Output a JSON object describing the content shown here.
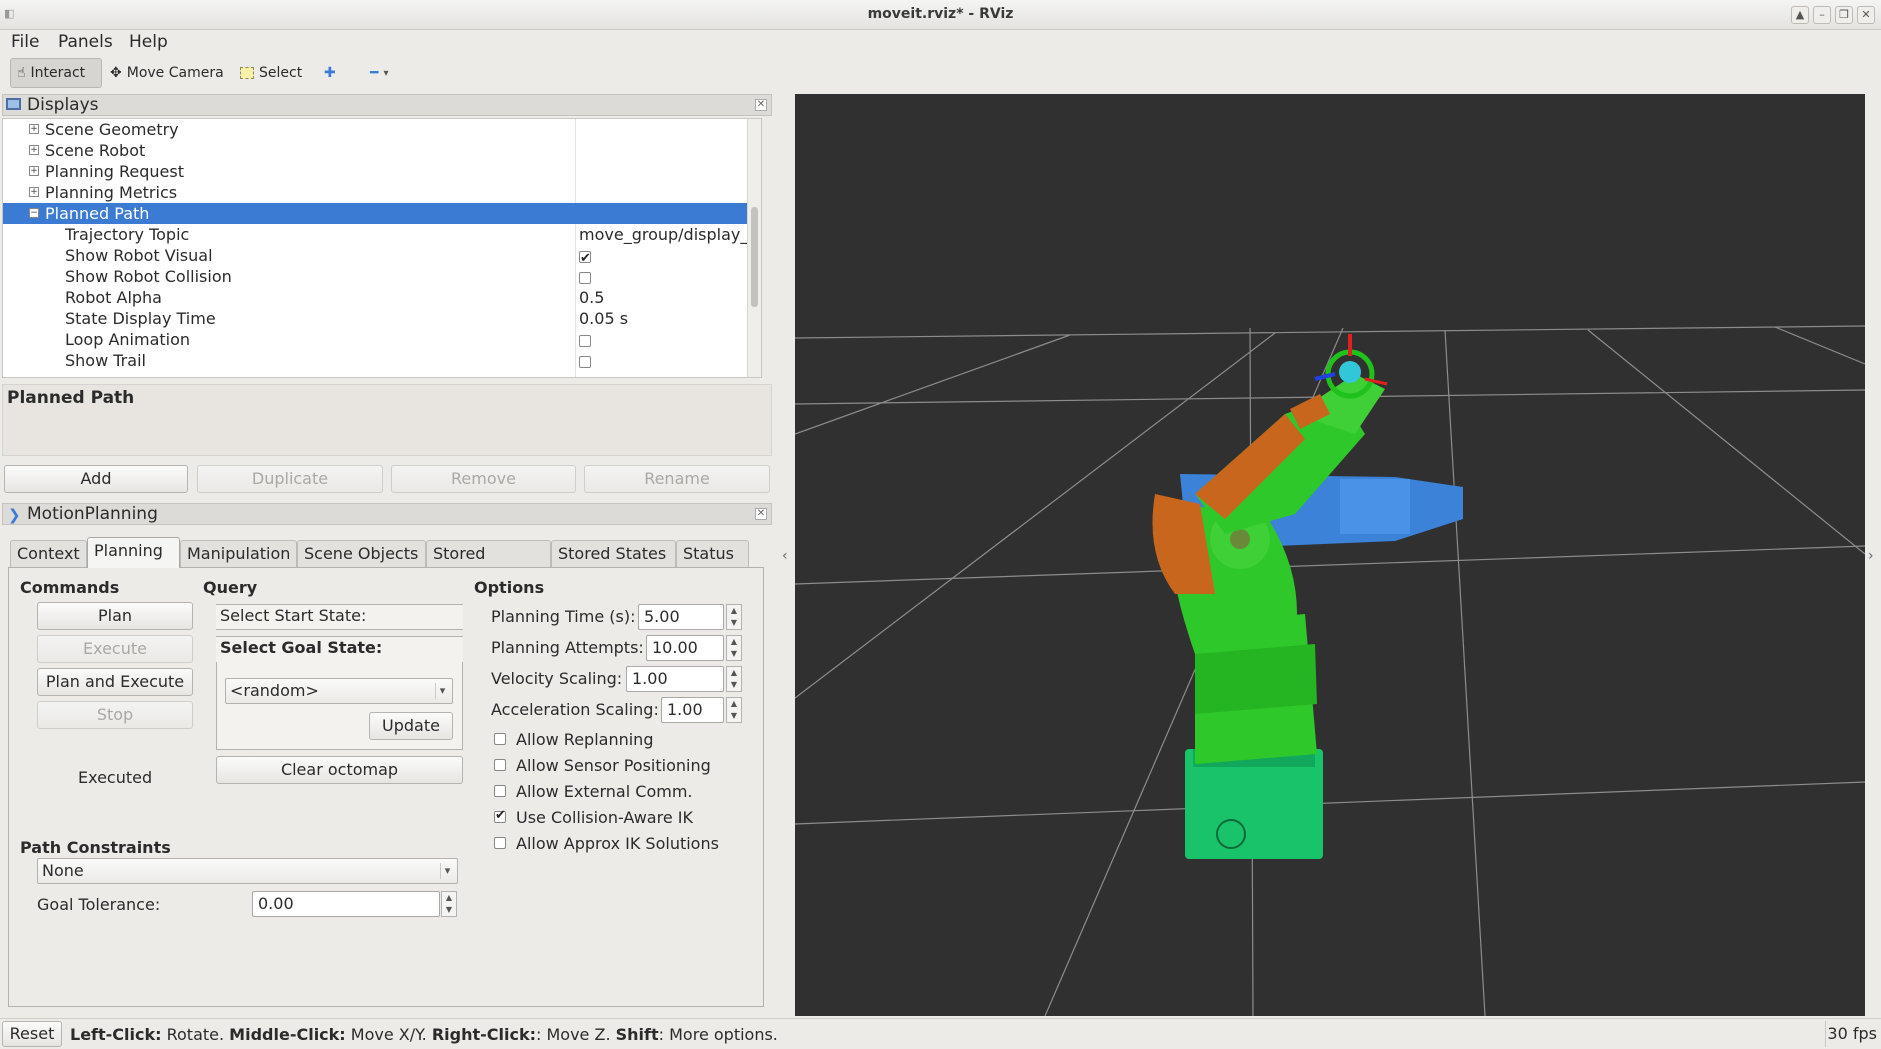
{
  "window": {
    "title": "moveit.rviz* - RViz"
  },
  "menu": {
    "file": "File",
    "panels": "Panels",
    "help": "Help"
  },
  "toolbar": {
    "interact": "Interact",
    "move_camera": "Move Camera",
    "select": "Select"
  },
  "displays": {
    "title": "Displays",
    "items": [
      {
        "label": "Scene Geometry"
      },
      {
        "label": "Scene Robot"
      },
      {
        "label": "Planning Request"
      },
      {
        "label": "Planning Metrics"
      },
      {
        "label": "Planned Path"
      }
    ],
    "properties": [
      {
        "label": "Trajectory Topic",
        "value": "move_group/display_..."
      },
      {
        "label": "Show Robot Visual",
        "checked": true
      },
      {
        "label": "Show Robot Collision",
        "checked": false
      },
      {
        "label": "Robot Alpha",
        "value": "0.5"
      },
      {
        "label": "State Display Time",
        "value": "0.05 s"
      },
      {
        "label": "Loop Animation",
        "checked": false
      },
      {
        "label": "Show Trail",
        "checked": false
      }
    ],
    "description_title": "Planned Path",
    "buttons": {
      "add": "Add",
      "duplicate": "Duplicate",
      "remove": "Remove",
      "rename": "Rename"
    }
  },
  "motion_planning": {
    "title": "MotionPlanning",
    "tabs": [
      "Context",
      "Planning",
      "Manipulation",
      "Scene Objects",
      "Stored Scenes",
      "Stored States",
      "Status"
    ],
    "active_tab": "Planning",
    "commands": {
      "heading": "Commands",
      "plan": "Plan",
      "execute": "Execute",
      "plan_and_execute": "Plan and Execute",
      "stop": "Stop",
      "status": "Executed"
    },
    "query": {
      "heading": "Query",
      "start_state": "Select Start State:",
      "goal_state": "Select Goal State:",
      "goal_value": "<random>",
      "update": "Update",
      "clear_octomap": "Clear octomap"
    },
    "options": {
      "heading": "Options",
      "planning_time_label": "Planning Time (s):",
      "planning_time": "5.00",
      "planning_attempts_label": "Planning Attempts:",
      "planning_attempts": "10.00",
      "velocity_scaling_label": "Velocity Scaling:",
      "velocity_scaling": "1.00",
      "acceleration_scaling_label": "Acceleration Scaling:",
      "acceleration_scaling": "1.00",
      "allow_replanning": "Allow Replanning",
      "allow_replanning_checked": false,
      "allow_sensor_positioning": "Allow Sensor Positioning",
      "allow_sensor_positioning_checked": false,
      "allow_external_comm": "Allow External Comm.",
      "allow_external_comm_checked": false,
      "use_collision_aware_ik": "Use Collision-Aware IK",
      "use_collision_aware_ik_checked": true,
      "allow_approx_ik": "Allow Approx IK Solutions",
      "allow_approx_ik_checked": false
    },
    "path_constraints": {
      "heading": "Path Constraints",
      "value": "None",
      "goal_tolerance_label": "Goal Tolerance:",
      "goal_tolerance": "0.00"
    }
  },
  "statusbar": {
    "reset": "Reset",
    "hint_left_key": "Left-Click:",
    "hint_left": " Rotate. ",
    "hint_middle_key": "Middle-Click:",
    "hint_middle": " Move X/Y. ",
    "hint_right_key": "Right-Click:",
    "hint_right": ": Move Z. ",
    "hint_shift_key": "Shift",
    "hint_shift": ": More options.",
    "fps": "30 fps"
  },
  "colors": {
    "selection": "#3b7bd4",
    "viewport_bg": "#303030",
    "robot_green": "#2fc82a",
    "robot_orange": "#c8661d",
    "robot_blue": "#3b82d8",
    "base_green": "#19c36a"
  }
}
